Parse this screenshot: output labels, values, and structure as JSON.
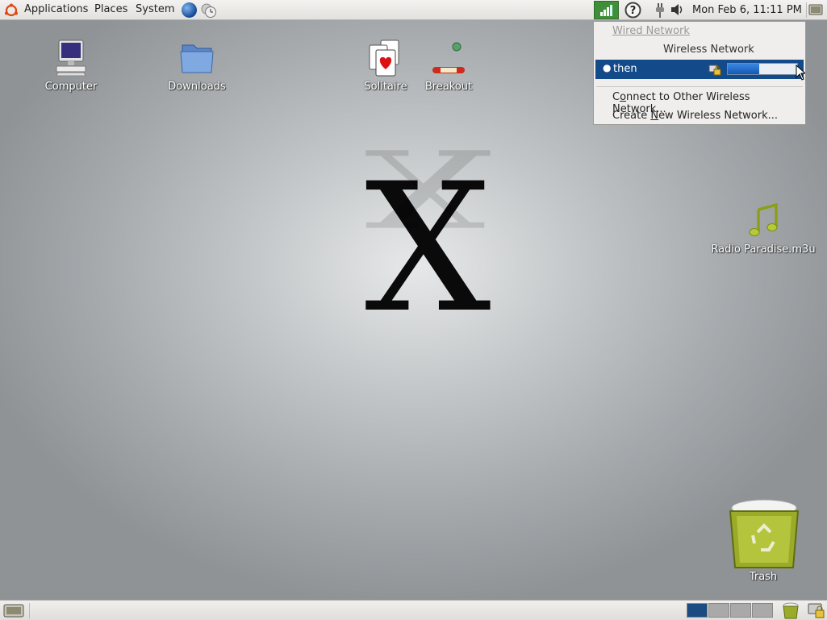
{
  "top_panel": {
    "menus": [
      "Applications",
      "Places",
      "System"
    ],
    "clock": "Mon Feb  6, 11:11 PM"
  },
  "desktop": {
    "icons": [
      {
        "label": "Computer",
        "icon": "computer-icon"
      },
      {
        "label": "Downloads",
        "icon": "folder-icon"
      },
      {
        "label": "Solitaire",
        "icon": "cards-icon"
      },
      {
        "label": "Breakout",
        "icon": "paddle-icon"
      },
      {
        "label": "Radio Paradise.m3u",
        "icon": "music-note-icon"
      },
      {
        "label": "Trash",
        "icon": "trash-icon"
      }
    ],
    "wallpaper_letter": "X"
  },
  "network_menu": {
    "wired_header": "Wired Network",
    "wireless_header": "Wireless Network",
    "selected_network": "then",
    "signal_strength": 0.45,
    "connect_other_pre": "C",
    "connect_other_u": "o",
    "connect_other_post": "nnect to Other Wireless Network...",
    "create_new_pre": "Create ",
    "create_new_u": "N",
    "create_new_post": "ew Wireless Network..."
  },
  "colors": {
    "selection": "#134a8a",
    "workspace_active": "#1c4b82",
    "workspace_inactive": "#a9a9a9"
  },
  "bottom_panel": {
    "workspaces": 4,
    "active_workspace": 1
  }
}
